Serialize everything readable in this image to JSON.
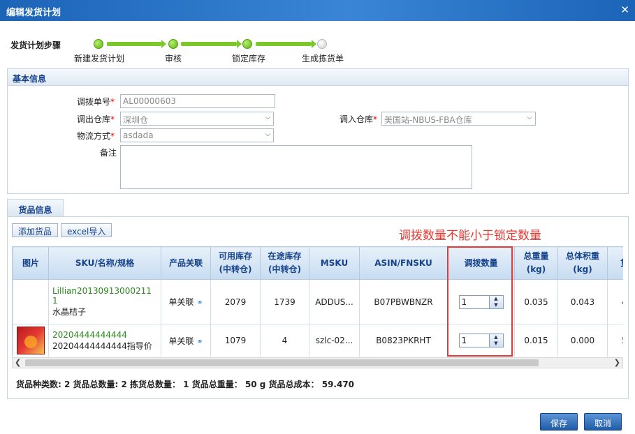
{
  "window": {
    "title": "编辑发货计划",
    "close_glyph": "✕"
  },
  "steps": {
    "label": "发货计划步骤",
    "items": [
      "新建发货计划",
      "审核",
      "锁定库存",
      "生成拣货单"
    ]
  },
  "basic": {
    "header": "基本信息",
    "transfer_no_label": "调拨单号",
    "transfer_no_value": "AL00000603",
    "out_wh_label": "调出仓库",
    "out_wh_value": "深圳仓",
    "in_wh_label": "调入仓库",
    "in_wh_value": "美国站-NBUS-FBA仓库",
    "logistics_label": "物流方式",
    "logistics_value": "asdada",
    "remark_label": "备注",
    "required_mark": "*"
  },
  "goods": {
    "tab": "货品信息",
    "add_button": "添加货品",
    "import_button": "excel导入",
    "note": "调拨数量不能小于锁定数量",
    "columns": {
      "image": "图片",
      "sku": "SKU/名称/规格",
      "relation": "产品关联",
      "avail_1": "可用库存",
      "avail_2": "(中转仓)",
      "transit_1": "在途库存",
      "transit_2": "(中转仓)",
      "msku": "MSKU",
      "asin": "ASIN/FNSKU",
      "qty": "调拨数量",
      "weight_1": "总重量",
      "weight_2": "(kg)",
      "volume_1": "总体积重",
      "volume_2": "(kg)",
      "more": "货"
    },
    "rows": [
      {
        "sku_line1": "Lillian20130913000211",
        "sku_line2": "1",
        "name": "水晶桔子",
        "relation": "单关联",
        "avail": "2079",
        "transit": "1739",
        "msku": "ADDUS...",
        "asin": "B07PBWBNZR",
        "qty": "1",
        "weight": "0.035",
        "volume": "0.043",
        "more": "4"
      },
      {
        "sku_line1": "20204444444444",
        "sku_line2": "",
        "name": "20204444444444指导价",
        "relation": "单关联",
        "avail": "1079",
        "transit": "4",
        "msku": "szlc-02...",
        "asin": "B0823PKRHT",
        "qty": "1",
        "weight": "0.015",
        "volume": "0.000",
        "more": "5"
      }
    ],
    "summary": "货品种类数: 2 货品总数量: 2 拣货总数量： 1 货品总重量： 50 g 货品总成本： 59.470"
  },
  "footer": {
    "save": "保存",
    "cancel": "取消"
  }
}
